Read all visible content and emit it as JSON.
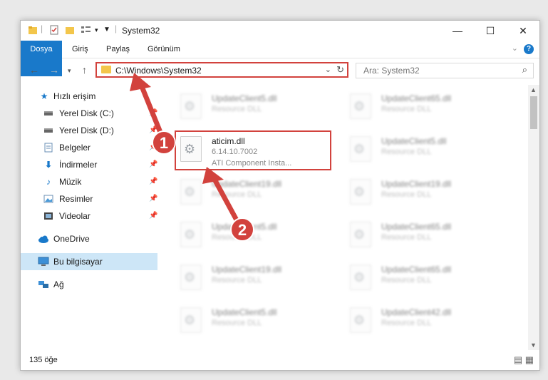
{
  "window": {
    "title": "System32"
  },
  "titlebar": {
    "minimize": "—",
    "maximize": "☐",
    "close": "✕"
  },
  "ribbon": {
    "tabs": [
      "Dosya",
      "Giriş",
      "Paylaş",
      "Görünüm"
    ],
    "help": "?"
  },
  "address": {
    "path": "C:\\Windows\\System32"
  },
  "search": {
    "placeholder": "Ara: System32"
  },
  "sidebar": {
    "items": [
      {
        "label": "Hızlı erişim",
        "icon": "star-icon"
      },
      {
        "label": "Yerel Disk (C:)",
        "icon": "drive-icon"
      },
      {
        "label": "Yerel Disk (D:)",
        "icon": "drive-icon"
      },
      {
        "label": "Belgeler",
        "icon": "documents-icon"
      },
      {
        "label": "İndirmeler",
        "icon": "download-icon"
      },
      {
        "label": "Müzik",
        "icon": "music-icon"
      },
      {
        "label": "Resimler",
        "icon": "pictures-icon"
      },
      {
        "label": "Videolar",
        "icon": "video-icon"
      },
      {
        "label": "OneDrive",
        "icon": "cloud-icon"
      },
      {
        "label": "Bu bilgisayar",
        "icon": "computer-icon"
      },
      {
        "label": "Ağ",
        "icon": "network-icon"
      }
    ]
  },
  "files": {
    "focus": {
      "name": "aticim.dll",
      "version": "6.14.10.7002",
      "description": "ATI Component Insta..."
    },
    "blurred": [
      {
        "name": "UpdateClient5.dll",
        "type": "Resource DLL"
      },
      {
        "name": "UpdateClient65.dll",
        "type": "Resource DLL"
      },
      {
        "name": "UpdateClient5.dll",
        "type": "Resource DLL"
      },
      {
        "name": "UpdateClient19.dll",
        "type": "Resource DLL"
      },
      {
        "name": "UpdateClient19.dll",
        "type": "Resource DLL"
      },
      {
        "name": "UpdateClient5.dll",
        "type": "Resource DLL"
      },
      {
        "name": "UpdateClient65.dll",
        "type": "Resource DLL"
      },
      {
        "name": "UpdateClient19.dll",
        "type": "Resource DLL"
      },
      {
        "name": "UpdateClient65.dll",
        "type": "Resource DLL"
      },
      {
        "name": "UpdateClient5.dll",
        "type": "Resource DLL"
      },
      {
        "name": "UpdateClient42.dll",
        "type": "Resource DLL"
      }
    ]
  },
  "status": {
    "count": "135 öğe"
  },
  "annotations": {
    "marker1": "1",
    "marker2": "2"
  },
  "colors": {
    "accent": "#1979ca",
    "highlight": "#d2423d",
    "selected": "#cde6f7"
  }
}
